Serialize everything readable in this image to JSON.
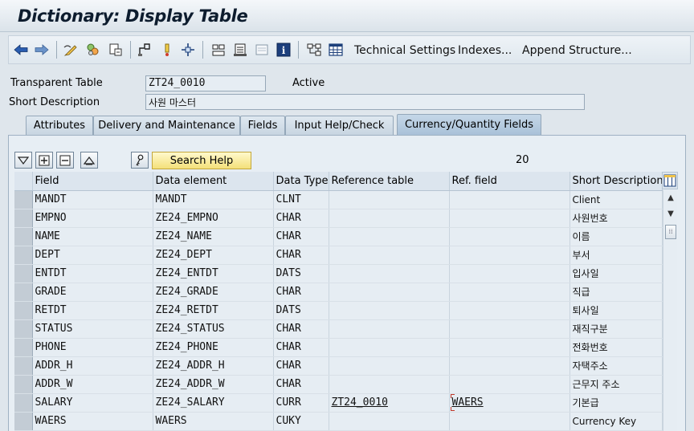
{
  "window": {
    "title": "Dictionary: Display Table"
  },
  "toolbar": {
    "icons": [
      "back-arrow-icon",
      "forward-arrow-icon",
      "display-change-icon",
      "other-object-icon",
      "activate-icon",
      "where-used-icon",
      "hierarchy-icon",
      "object-list-icon",
      "navigation-window-icon",
      "utilities-icon",
      "contents-icon",
      "info-icon",
      "graphic-icon",
      "table-structure-icon"
    ],
    "technical_settings": "Technical Settings",
    "indexes": "Indexes...",
    "append_structure": "Append Structure..."
  },
  "header": {
    "table_type_label": "Transparent Table",
    "table_name": "ZT24_0010",
    "status": "Active",
    "short_desc_label": "Short Description",
    "short_desc": "사원 마스터"
  },
  "tabs": [
    {
      "label": "Attributes",
      "active": false
    },
    {
      "label": "Delivery and Maintenance",
      "active": false
    },
    {
      "label": "Fields",
      "active": false
    },
    {
      "label": "Input Help/Check",
      "active": false
    },
    {
      "label": "Currency/Quantity Fields",
      "active": true
    }
  ],
  "table_toolbar": {
    "search_help_label": "Search Help",
    "count": "20"
  },
  "columns": [
    "Field",
    "Data element",
    "Data Type",
    "Reference table",
    "Ref. field",
    "Short Description"
  ],
  "rows": [
    {
      "field": "MANDT",
      "element": "MANDT",
      "type": "CLNT",
      "ref_table": "",
      "ref_field": "",
      "desc": "Client"
    },
    {
      "field": "EMPNO",
      "element": "ZE24_EMPNO",
      "type": "CHAR",
      "ref_table": "",
      "ref_field": "",
      "desc": "사원번호"
    },
    {
      "field": "NAME",
      "element": "ZE24_NAME",
      "type": "CHAR",
      "ref_table": "",
      "ref_field": "",
      "desc": "이름"
    },
    {
      "field": "DEPT",
      "element": "ZE24_DEPT",
      "type": "CHAR",
      "ref_table": "",
      "ref_field": "",
      "desc": "부서"
    },
    {
      "field": "ENTDT",
      "element": "ZE24_ENTDT",
      "type": "DATS",
      "ref_table": "",
      "ref_field": "",
      "desc": "입사일"
    },
    {
      "field": "GRADE",
      "element": "ZE24_GRADE",
      "type": "CHAR",
      "ref_table": "",
      "ref_field": "",
      "desc": "직급"
    },
    {
      "field": "RETDT",
      "element": "ZE24_RETDT",
      "type": "DATS",
      "ref_table": "",
      "ref_field": "",
      "desc": "퇴사일"
    },
    {
      "field": "STATUS",
      "element": "ZE24_STATUS",
      "type": "CHAR",
      "ref_table": "",
      "ref_field": "",
      "desc": "재직구분"
    },
    {
      "field": "PHONE",
      "element": "ZE24_PHONE",
      "type": "CHAR",
      "ref_table": "",
      "ref_field": "",
      "desc": "전화번호"
    },
    {
      "field": "ADDR_H",
      "element": "ZE24_ADDR_H",
      "type": "CHAR",
      "ref_table": "",
      "ref_field": "",
      "desc": "자택주소"
    },
    {
      "field": "ADDR_W",
      "element": "ZE24_ADDR_W",
      "type": "CHAR",
      "ref_table": "",
      "ref_field": "",
      "desc": "근무지 주소"
    },
    {
      "field": "SALARY",
      "element": "ZE24_SALARY",
      "type": "CURR",
      "ref_table": "ZT24_0010",
      "ref_field": "WAERS",
      "desc": "기본급"
    },
    {
      "field": "WAERS",
      "element": "WAERS",
      "type": "CUKY",
      "ref_table": "",
      "ref_field": "",
      "desc": "Currency Key"
    }
  ]
}
